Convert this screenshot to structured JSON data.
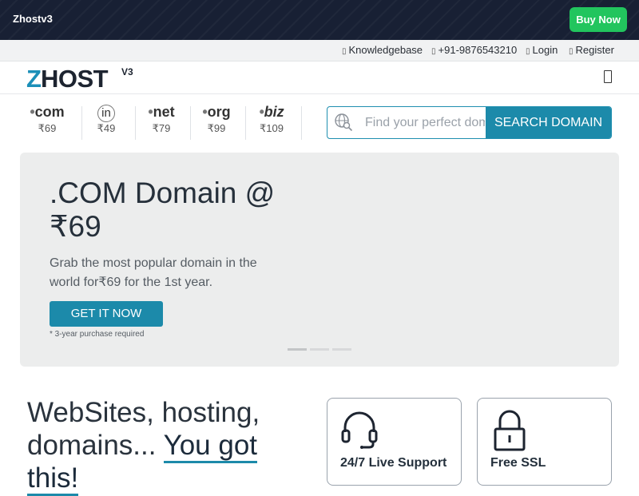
{
  "topbar": {
    "brand": "Zhostv3",
    "buy_label": "Buy Now"
  },
  "utility": {
    "knowledgebase": "Knowledgebase",
    "phone": "+91-9876543210",
    "login": "Login",
    "register": "Register"
  },
  "logo": {
    "z": "Z",
    "host": "HOST",
    "version": "V3"
  },
  "tlds": [
    {
      "name": "com",
      "price": "₹69"
    },
    {
      "name": "in",
      "price": "₹49"
    },
    {
      "name": "net",
      "price": "₹79"
    },
    {
      "name": "org",
      "price": "₹99"
    },
    {
      "name": "biz",
      "price": "₹109"
    }
  ],
  "search": {
    "placeholder": "Find your perfect domain",
    "button_label": "SEARCH DOMAIN"
  },
  "hero": {
    "title": ".COM Domain @ ₹69",
    "description": "Grab the most popular domain in the world for₹69 for the 1st year.",
    "cta_label": "GET IT NOW",
    "note": "* 3-year purchase required"
  },
  "section": {
    "headline_prefix": "WebSites, hosting, domains... ",
    "headline_highlight": "You got this!"
  },
  "features": [
    {
      "title": "24/7 Live Support",
      "icon": "headset-icon"
    },
    {
      "title": "Free SSL",
      "icon": "padlock-icon"
    }
  ],
  "colors": {
    "accent": "#1c8aaa",
    "buy": "#22c55e",
    "topbar": "#182034",
    "hero_bg": "#eceded"
  }
}
